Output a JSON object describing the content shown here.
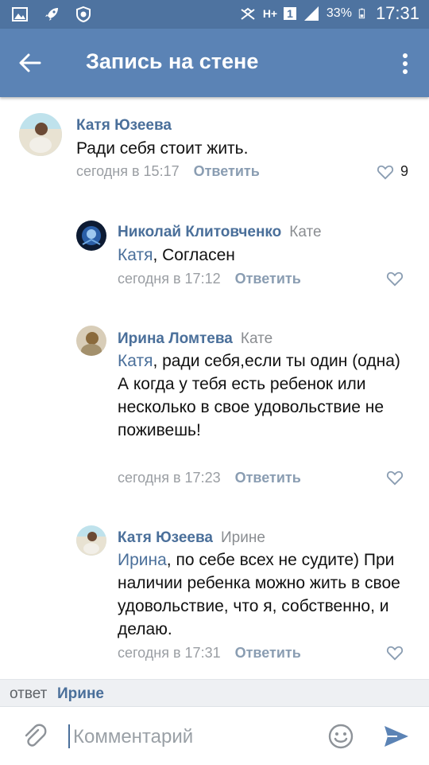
{
  "status_bar": {
    "battery": "33%",
    "time": "17:31",
    "network": "H+",
    "sim": "1"
  },
  "app_bar": {
    "title": "Запись на стене"
  },
  "comments": [
    {
      "author": "Катя Юзеева",
      "reply_to": "",
      "mention": "",
      "text": "Ради себя стоит жить.",
      "time": "сегодня в 15:17",
      "reply_label": "Ответить",
      "likes": "9"
    },
    {
      "author": "Николай Клитовченко",
      "reply_to": "Кате",
      "mention": "Катя",
      "text": ", Согласен",
      "time": "сегодня в 17:12",
      "reply_label": "Ответить",
      "likes": ""
    },
    {
      "author": "Ирина Ломтева",
      "reply_to": "Кате",
      "mention": "Катя",
      "text": ", ради себя,если ты один (одна)\nА когда у тебя есть ребенок или несколько в свое удовольствие не поживешь!",
      "time": "сегодня в 17:23",
      "reply_label": "Ответить",
      "likes": ""
    },
    {
      "author": "Катя Юзеева",
      "reply_to": "Ирине",
      "mention": "Ирина",
      "text": ", по себе всех не судите) При наличии ребенка можно жить в свое удовольствие, что я, собственно, и делаю.",
      "time": "сегодня в 17:31",
      "reply_label": "Ответить",
      "likes": ""
    }
  ],
  "reply_bar": {
    "prefix": "ответ",
    "target": "Ирине"
  },
  "composer": {
    "placeholder": "Комментарий"
  },
  "colors": {
    "status_bar": "#4e73a0",
    "app_bar": "#5b83b5",
    "link": "#4a6f9a"
  }
}
